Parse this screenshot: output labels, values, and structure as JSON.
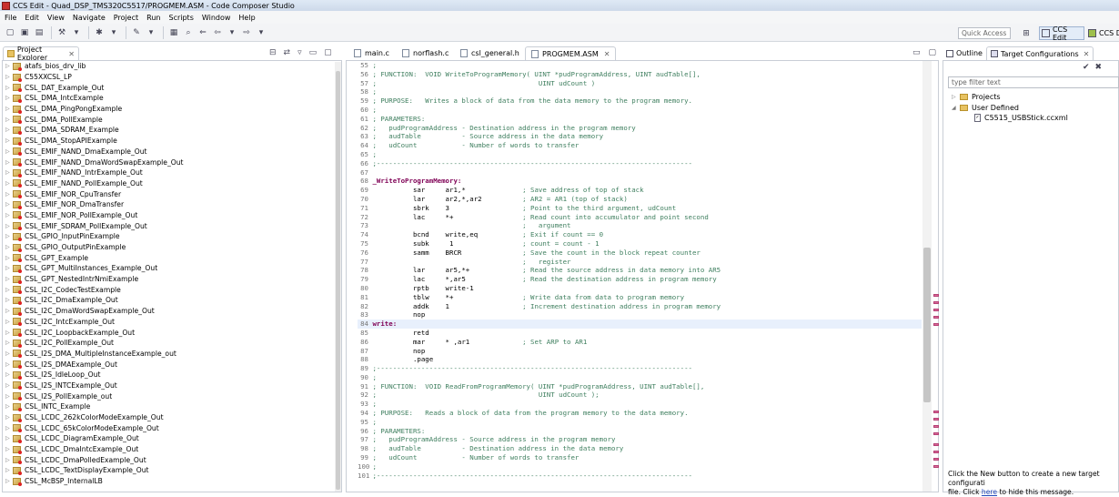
{
  "window": {
    "title": "CCS Edit - Quad_DSP_TMS320C5517/PROGMEM.ASM - Code Composer Studio"
  },
  "menu": [
    "File",
    "Edit",
    "View",
    "Navigate",
    "Project",
    "Run",
    "Scripts",
    "Window",
    "Help"
  ],
  "toolbar": {
    "quick_access": "Quick Access",
    "perspective_active": "CCS Edit",
    "perspective_other": "CCS D"
  },
  "project_explorer": {
    "title": "Project Explorer",
    "items": [
      "atafs_bios_drv_lib",
      "C55XXCSL_LP",
      "CSL_DAT_Example_Out",
      "CSL_DMA_IntcExample",
      "CSL_DMA_PingPongExample",
      "CSL_DMA_PollExample",
      "CSL_DMA_SDRAM_Example",
      "CSL_DMA_StopAPIExample",
      "CSL_EMIF_NAND_DmaExample_Out",
      "CSL_EMIF_NAND_DmaWordSwapExample_Out",
      "CSL_EMIF_NAND_IntrExample_Out",
      "CSL_EMIF_NAND_PollExample_Out",
      "CSL_EMIF_NOR_CpuTransfer",
      "CSL_EMIF_NOR_DmaTransfer",
      "CSL_EMIF_NOR_PollExample_Out",
      "CSL_EMIF_SDRAM_PollExample_Out",
      "CSL_GPIO_InputPinExample",
      "CSL_GPIO_OutputPinExample",
      "CSL_GPT_Example",
      "CSL_GPT_MultiInstances_Example_Out",
      "CSL_GPT_NestedIntrNmiExample",
      "CSL_I2C_CodecTestExample",
      "CSL_I2C_DmaExample_Out",
      "CSL_I2C_DmaWordSwapExample_Out",
      "CSL_I2C_IntcExample_Out",
      "CSL_I2C_LoopbackExample_Out",
      "CSL_I2C_PollExample_Out",
      "CSL_I2S_DMA_MultipleInstanceExample_out",
      "CSL_I2S_DMAExample_Out",
      "CSL_I2S_IdleLoop_Out",
      "CSL_I2S_INTCExample_Out",
      "CSL_I2S_PollExample_out",
      "CSL_INTC_Example",
      "CSL_LCDC_262kColorModeExample_Out",
      "CSL_LCDC_65kColorModeExample_Out",
      "CSL_LCDC_DiagramExample_Out",
      "CSL_LCDC_DmaIntcExample_Out",
      "CSL_LCDC_DmaPolledExample_Out",
      "CSL_LCDC_TextDisplayExample_Out",
      "CSL_McBSP_InternalLB"
    ]
  },
  "editor": {
    "tabs": [
      {
        "label": "main.c",
        "active": false
      },
      {
        "label": "norflash.c",
        "active": false
      },
      {
        "label": "csl_general.h",
        "active": false
      },
      {
        "label": "PROGMEM.ASM",
        "active": true
      }
    ],
    "lines": [
      {
        "n": "55",
        "t": ";",
        "k": "cm",
        "e": false
      },
      {
        "n": "56",
        "t": "; FUNCTION:  VOID WriteToProgramMemory( UINT *pudProgramAddress, UINT audTable[],",
        "k": "cm",
        "e": false
      },
      {
        "n": "57",
        "t": ";                                        UINT udCount )",
        "k": "cm",
        "e": false
      },
      {
        "n": "58",
        "t": ";",
        "k": "cm",
        "e": false
      },
      {
        "n": "59",
        "t": "; PURPOSE:   Writes a block of data from the data memory to the program memory.",
        "k": "cm",
        "e": false
      },
      {
        "n": "60",
        "t": ";",
        "k": "cm",
        "e": false
      },
      {
        "n": "61",
        "t": "; PARAMETERS:",
        "k": "cm",
        "e": false
      },
      {
        "n": "62",
        "t": ";   pudProgramAddress - Destination address in the program memory",
        "k": "cm",
        "e": false
      },
      {
        "n": "63",
        "t": ";   audTable          - Source address in the data memory",
        "k": "cm",
        "e": false
      },
      {
        "n": "64",
        "t": ";   udCount           - Number of words to transfer",
        "k": "cm",
        "e": false
      },
      {
        "n": "65",
        "t": ";",
        "k": "cm",
        "e": false
      },
      {
        "n": "66",
        "t": ";------------------------------------------------------------------------------",
        "k": "cm",
        "e": false
      },
      {
        "n": "67",
        "t": "",
        "k": "",
        "e": false
      },
      {
        "n": "68",
        "t": "_WriteToProgramMemory:",
        "k": "lb",
        "e": false
      },
      {
        "n": "69",
        "t": "          sar     ar1,*              ; Save address of top of stack",
        "k": "mix",
        "e": true
      },
      {
        "n": "70",
        "t": "          lar     ar2,*,ar2          ; AR2 = AR1 (top of stack)",
        "k": "mix",
        "e": true
      },
      {
        "n": "71",
        "t": "          sbrk    3                  ; Point to the third argument, udCount",
        "k": "mix",
        "e": true
      },
      {
        "n": "72",
        "t": "          lac     *+                 ; Read count into accumulator and point second",
        "k": "mix",
        "e": true
      },
      {
        "n": "73",
        "t": "                                     ;   argument",
        "k": "mix",
        "e": false
      },
      {
        "n": "74",
        "t": "          bcnd    write,eq           ; Exit if count == 0",
        "k": "mix",
        "e": true
      },
      {
        "n": "75",
        "t": "          subk     1                 ; count = count - 1",
        "k": "mix",
        "e": true
      },
      {
        "n": "76",
        "t": "          samm    BRCR               ; Save the count in the block repeat counter",
        "k": "mix",
        "e": true
      },
      {
        "n": "77",
        "t": "                                     ;   register",
        "k": "mix",
        "e": false
      },
      {
        "n": "78",
        "t": "          lar     ar5,*+             ; Read the source address in data memory into AR5",
        "k": "mix",
        "e": true
      },
      {
        "n": "79",
        "t": "          lac     *,ar5              ; Read the destination address in program memory",
        "k": "mix",
        "e": true
      },
      {
        "n": "80",
        "t": "          rptb    write-1",
        "k": "",
        "e": false
      },
      {
        "n": "81",
        "t": "          tblw    *+                 ; Write data from data to program memory",
        "k": "mix",
        "e": true
      },
      {
        "n": "82",
        "t": "          addk    1                  ; Increment destination address in program memory",
        "k": "mix",
        "e": true
      },
      {
        "n": "83",
        "t": "          nop",
        "k": "",
        "e": false
      },
      {
        "n": "84",
        "t": "write:",
        "k": "lb",
        "e": false
      },
      {
        "n": "85",
        "t": "          retd",
        "k": "",
        "e": false
      },
      {
        "n": "86",
        "t": "          mar     * ,ar1             ; Set ARP to AR1",
        "k": "mix",
        "e": true
      },
      {
        "n": "87",
        "t": "          nop",
        "k": "",
        "e": false
      },
      {
        "n": "88",
        "t": "          .page",
        "k": "",
        "e": false
      },
      {
        "n": "89",
        "t": ";------------------------------------------------------------------------------",
        "k": "cm",
        "e": false
      },
      {
        "n": "90",
        "t": ";",
        "k": "cm",
        "e": false
      },
      {
        "n": "91",
        "t": "; FUNCTION:  VOID ReadFromProgramMemory( UINT *pudProgramAddress, UINT audTable[],",
        "k": "cm",
        "e": false
      },
      {
        "n": "92",
        "t": ";                                        UINT udCount );",
        "k": "cm",
        "e": false
      },
      {
        "n": "93",
        "t": ";",
        "k": "cm",
        "e": false
      },
      {
        "n": "94",
        "t": "; PURPOSE:   Reads a block of data from the program memory to the data memory.",
        "k": "cm",
        "e": false
      },
      {
        "n": "95",
        "t": ";",
        "k": "cm",
        "e": false
      },
      {
        "n": "96",
        "t": "; PARAMETERS:",
        "k": "cm",
        "e": false
      },
      {
        "n": "97",
        "t": ";   pudProgramAddress - Source address in the program memory",
        "k": "cm",
        "e": false
      },
      {
        "n": "98",
        "t": ";   audTable          - Destination address in the data memory",
        "k": "cm",
        "e": false
      },
      {
        "n": "99",
        "t": ";   udCount           - Number of words to transfer",
        "k": "cm",
        "e": false
      },
      {
        "n": "100",
        "t": ";",
        "k": "cm",
        "e": false
      },
      {
        "n": "101",
        "t": ";------------------------------------------------------------------------------",
        "k": "cm",
        "e": false
      }
    ]
  },
  "right_panel": {
    "tab_outline": "Outline",
    "tab_targets": "Target Configurations",
    "filter_placeholder": "type filter text",
    "projects": "Projects",
    "user_defined": "User Defined",
    "config_file": "C5515_USBStick.ccxml",
    "hint_before": "Click the New button to create a new target configurati",
    "hint_file": "file. Click ",
    "hint_link": "here",
    "hint_after": " to hide this message."
  },
  "colors": {
    "comment": "#3f7f5f",
    "label": "#7f0055",
    "error": "#c93431",
    "accent": "#3f6fb5"
  }
}
